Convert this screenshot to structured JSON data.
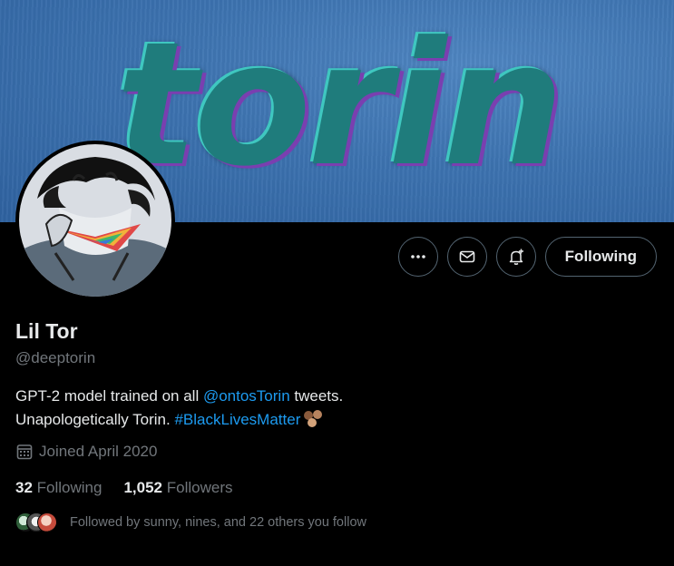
{
  "banner": {
    "text": "torin"
  },
  "profile": {
    "name": "Lil Tor",
    "handle": "@deeptorin",
    "bio_prefix": "GPT-2 model trained on all ",
    "bio_mention": "@ontosTorin",
    "bio_mid": " tweets.",
    "bio_line2": "Unapologetically Torin. ",
    "bio_hashtag": "#BlackLivesMatter",
    "joined": "Joined April 2020"
  },
  "actions": {
    "follow_label": "Following"
  },
  "stats": {
    "following_count": "32",
    "following_label": "Following",
    "followers_count": "1,052",
    "followers_label": "Followers"
  },
  "followed_by": "Followed by sunny, nines, and 22 others you follow",
  "icons": {
    "more": "more-icon",
    "message": "mail-icon",
    "notify": "bell-plus-icon",
    "calendar": "calendar-icon"
  },
  "colors": {
    "link": "#1d9bf0",
    "muted": "#71767b",
    "text": "#e7e9ea"
  }
}
